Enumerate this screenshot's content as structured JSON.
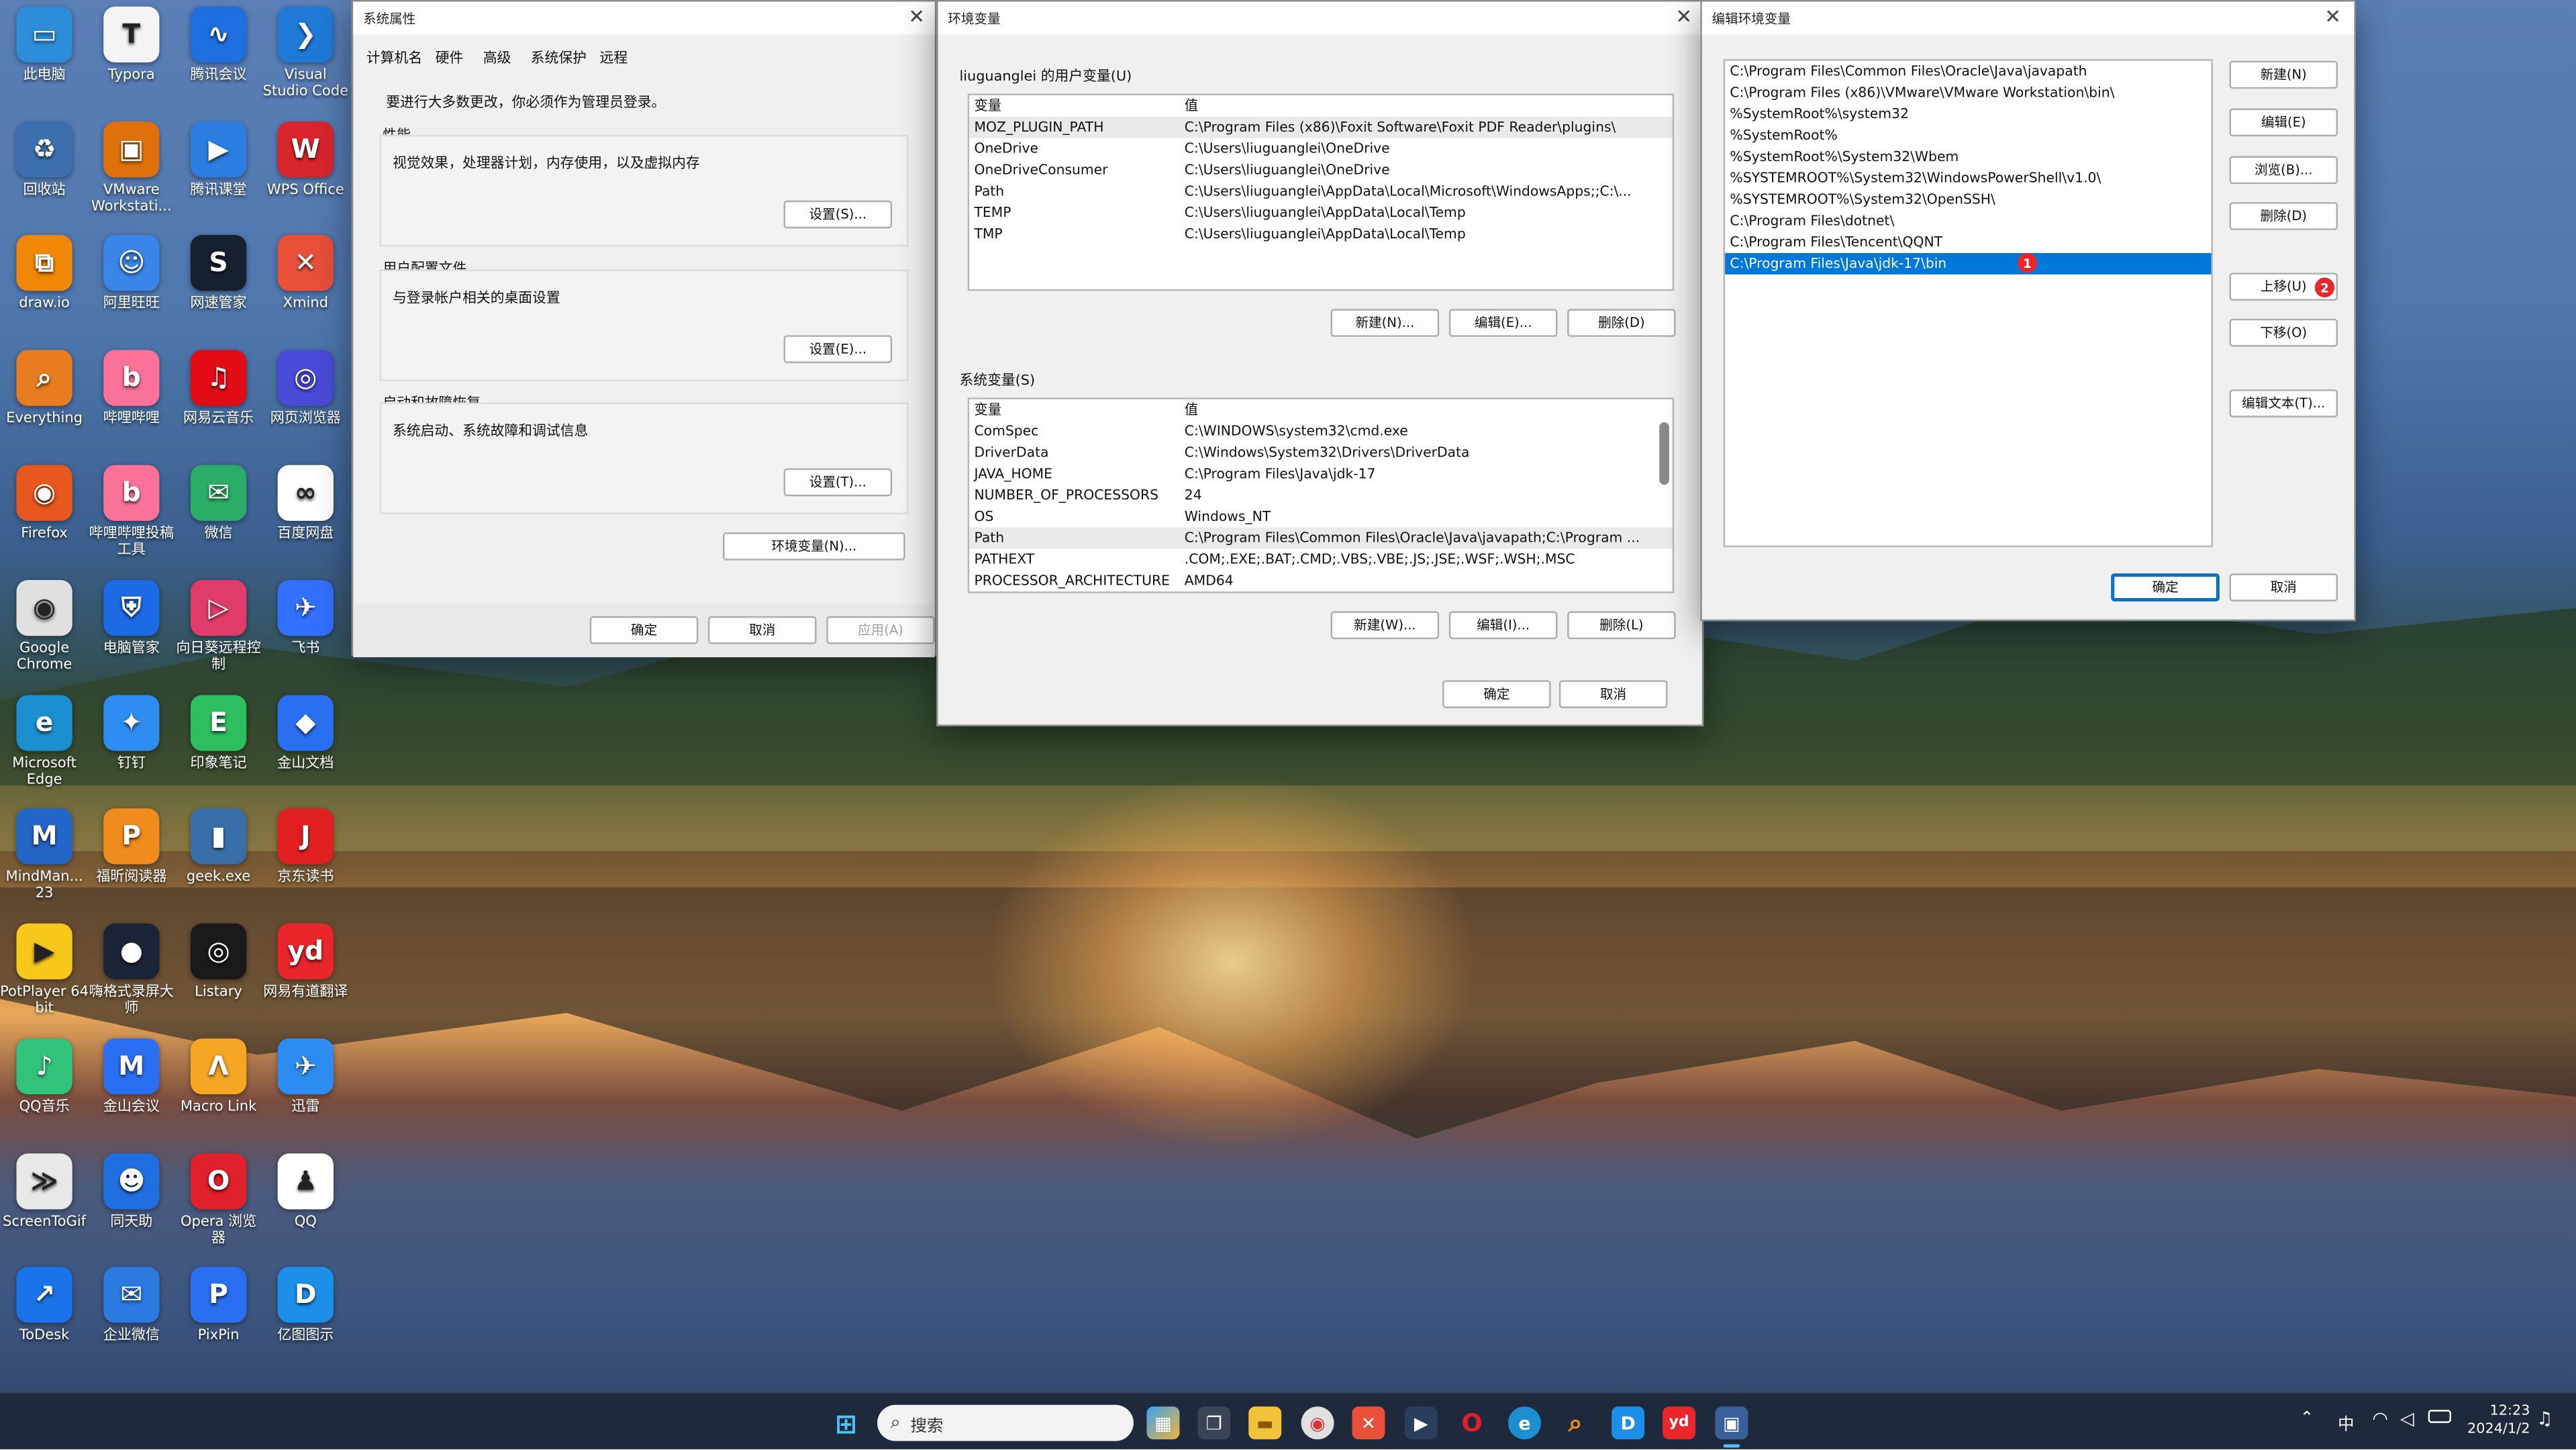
{
  "desktop_icons": [
    {
      "label": "此电脑",
      "color": "#2c8ed8",
      "glyph": "▭"
    },
    {
      "label": "Typora",
      "color": "#f4f4f4",
      "glyph": "T"
    },
    {
      "label": "腾讯会议",
      "color": "#1f6fe0",
      "glyph": "∿"
    },
    {
      "label": "Visual Studio Code",
      "color": "#1e7ad6",
      "glyph": "❯"
    },
    {
      "label": "回收站",
      "color": "#3d6fb0",
      "glyph": "♻"
    },
    {
      "label": "VMware Workstati...",
      "color": "#e0700c",
      "glyph": "▣"
    },
    {
      "label": "腾讯课堂",
      "color": "#2c7de0",
      "glyph": "▶"
    },
    {
      "label": "WPS Office",
      "color": "#d8262c",
      "glyph": "W"
    },
    {
      "label": "draw.io",
      "color": "#f08705",
      "glyph": "⧉"
    },
    {
      "label": "阿里旺旺",
      "color": "#3a86e8",
      "glyph": "☺"
    },
    {
      "label": "网速管家",
      "color": "#16202e",
      "glyph": "S"
    },
    {
      "label": "Xmind",
      "color": "#e8503a",
      "glyph": "✕"
    },
    {
      "label": "Everything",
      "color": "#e87c1e",
      "glyph": "⌕"
    },
    {
      "label": "哔哩哔哩",
      "color": "#fb7299",
      "glyph": "b"
    },
    {
      "label": "网易云音乐",
      "color": "#e20c17",
      "glyph": "♫"
    },
    {
      "label": "网页浏览器",
      "color": "#4a4ad8",
      "glyph": "◎"
    },
    {
      "label": "Firefox",
      "color": "#e8571e",
      "glyph": "◉"
    },
    {
      "label": "哔哩哔哩投稿工具",
      "color": "#fb7299",
      "glyph": "b"
    },
    {
      "label": "微信",
      "color": "#2aae67",
      "glyph": "✉"
    },
    {
      "label": "百度网盘",
      "color": "#ffffff",
      "glyph": "∞"
    },
    {
      "label": "Google Chrome",
      "color": "#e0e0e0",
      "glyph": "◉"
    },
    {
      "label": "电脑管家",
      "color": "#1c6ae4",
      "glyph": "⛨"
    },
    {
      "label": "向日葵远程控制",
      "color": "#e03c6a",
      "glyph": "▷"
    },
    {
      "label": "飞书",
      "color": "#3370ff",
      "glyph": "✈"
    },
    {
      "label": "Microsoft Edge",
      "color": "#1c8fd0",
      "glyph": "e"
    },
    {
      "label": "钉钉",
      "color": "#2f8cf0",
      "glyph": "✦"
    },
    {
      "label": "印象笔记",
      "color": "#2dbe60",
      "glyph": "E"
    },
    {
      "label": "金山文档",
      "color": "#2a6ef2",
      "glyph": "◆"
    },
    {
      "label": "MindMan... 23",
      "color": "#2466c8",
      "glyph": "M"
    },
    {
      "label": "福昕阅读器",
      "color": "#f08b1e",
      "glyph": "P"
    },
    {
      "label": "geek.exe",
      "color": "#3a6ea8",
      "glyph": "▮"
    },
    {
      "label": "京东读书",
      "color": "#e02020",
      "glyph": "J"
    },
    {
      "label": "PotPlayer 64 bit",
      "color": "#f6c81c",
      "glyph": "▶"
    },
    {
      "label": "嗨格式录屏大师",
      "color": "#1b2336",
      "glyph": "●"
    },
    {
      "label": "Listary",
      "color": "#1a1a1a",
      "glyph": "◎"
    },
    {
      "label": "网易有道翻译",
      "color": "#e8262c",
      "glyph": "yd"
    },
    {
      "label": "QQ音乐",
      "color": "#31c27c",
      "glyph": "♪"
    },
    {
      "label": "金山会议",
      "color": "#2a6ef2",
      "glyph": "M"
    },
    {
      "label": "Macro Link",
      "color": "#f5a623",
      "glyph": "Λ"
    },
    {
      "label": "迅雷",
      "color": "#2d8cf0",
      "glyph": "✈"
    },
    {
      "label": "ScreenToGif",
      "color": "#e8e8e8",
      "glyph": "≫"
    },
    {
      "label": "同天助",
      "color": "#1f6fe0",
      "glyph": "☻"
    },
    {
      "label": "Opera 浏览器",
      "color": "#e0202a",
      "glyph": "O"
    },
    {
      "label": "QQ",
      "color": "#ffffff",
      "glyph": "♟"
    },
    {
      "label": "ToDesk",
      "color": "#1a73e8",
      "glyph": "↗"
    },
    {
      "label": "企业微信",
      "color": "#2a7ae2",
      "glyph": "✉"
    },
    {
      "label": "PixPin",
      "color": "#2a6ef2",
      "glyph": "P"
    },
    {
      "label": "亿图图示",
      "color": "#1d8fe8",
      "glyph": "D"
    }
  ],
  "sysprops": {
    "title": "系统属性",
    "tabs": [
      "计算机名",
      "硬件",
      "高级",
      "系统保护",
      "远程"
    ],
    "admin_note": "要进行大多数更改，你必须作为管理员登录。",
    "perf_title": "性能",
    "perf_desc": "视觉效果，处理器计划，内存使用，以及虚拟内存",
    "perf_btn": "设置(S)...",
    "profile_title": "用户配置文件",
    "profile_desc": "与登录帐户相关的桌面设置",
    "profile_btn": "设置(E)...",
    "startup_title": "启动和故障恢复",
    "startup_desc": "系统启动、系统故障和调试信息",
    "startup_btn": "设置(T)...",
    "env_btn": "环境变量(N)...",
    "ok": "确定",
    "cancel": "取消",
    "apply": "应用(A)"
  },
  "envvars": {
    "title": "环境变量",
    "user_section": "liuguanglei 的用户变量(U)",
    "col_var": "变量",
    "col_val": "值",
    "user_vars": [
      {
        "name": "MOZ_PLUGIN_PATH",
        "value": "C:\\Program Files (x86)\\Foxit Software\\Foxit PDF Reader\\plugins\\"
      },
      {
        "name": "OneDrive",
        "value": "C:\\Users\\liuguanglei\\OneDrive"
      },
      {
        "name": "OneDriveConsumer",
        "value": "C:\\Users\\liuguanglei\\OneDrive"
      },
      {
        "name": "Path",
        "value": "C:\\Users\\liuguanglei\\AppData\\Local\\Microsoft\\WindowsApps;;C:\\..."
      },
      {
        "name": "TEMP",
        "value": "C:\\Users\\liuguanglei\\AppData\\Local\\Temp"
      },
      {
        "name": "TMP",
        "value": "C:\\Users\\liuguanglei\\AppData\\Local\\Temp"
      }
    ],
    "user_new": "新建(N)...",
    "user_edit": "编辑(E)...",
    "user_delete": "删除(D)",
    "sys_section": "系统变量(S)",
    "sys_vars": [
      {
        "name": "ComSpec",
        "value": "C:\\WINDOWS\\system32\\cmd.exe"
      },
      {
        "name": "DriverData",
        "value": "C:\\Windows\\System32\\Drivers\\DriverData"
      },
      {
        "name": "JAVA_HOME",
        "value": "C:\\Program Files\\Java\\jdk-17"
      },
      {
        "name": "NUMBER_OF_PROCESSORS",
        "value": "24"
      },
      {
        "name": "OS",
        "value": "Windows_NT"
      },
      {
        "name": "Path",
        "value": "C:\\Program Files\\Common Files\\Oracle\\Java\\javapath;C:\\Program ..."
      },
      {
        "name": "PATHEXT",
        "value": ".COM;.EXE;.BAT;.CMD;.VBS;.VBE;.JS;.JSE;.WSF;.WSH;.MSC"
      },
      {
        "name": "PROCESSOR_ARCHITECTURE",
        "value": "AMD64"
      }
    ],
    "sys_new": "新建(W)...",
    "sys_edit": "编辑(I)...",
    "sys_delete": "删除(L)",
    "ok": "确定",
    "cancel": "取消"
  },
  "editenv": {
    "title": "编辑环境变量",
    "paths": [
      "C:\\Program Files\\Common Files\\Oracle\\Java\\javapath",
      "C:\\Program Files (x86)\\VMware\\VMware Workstation\\bin\\",
      "%SystemRoot%\\system32",
      "%SystemRoot%",
      "%SystemRoot%\\System32\\Wbem",
      "%SYSTEMROOT%\\System32\\WindowsPowerShell\\v1.0\\",
      "%SYSTEMROOT%\\System32\\OpenSSH\\",
      "C:\\Program Files\\dotnet\\",
      "C:\\Program Files\\Tencent\\QQNT",
      "C:\\Program Files\\Java\\jdk-17\\bin"
    ],
    "selected_index": 9,
    "btn_new": "新建(N)",
    "btn_edit": "编辑(E)",
    "btn_browse": "浏览(B)...",
    "btn_delete": "删除(D)",
    "btn_up": "上移(U)",
    "btn_down": "下移(O)",
    "btn_edittext": "编辑文本(T)...",
    "ok": "确定",
    "cancel": "取消",
    "badge1": "1",
    "badge2": "2"
  },
  "taskbar": {
    "search_placeholder": "搜索",
    "ime": "中",
    "time": "12:23",
    "date": "2024/1/2"
  }
}
